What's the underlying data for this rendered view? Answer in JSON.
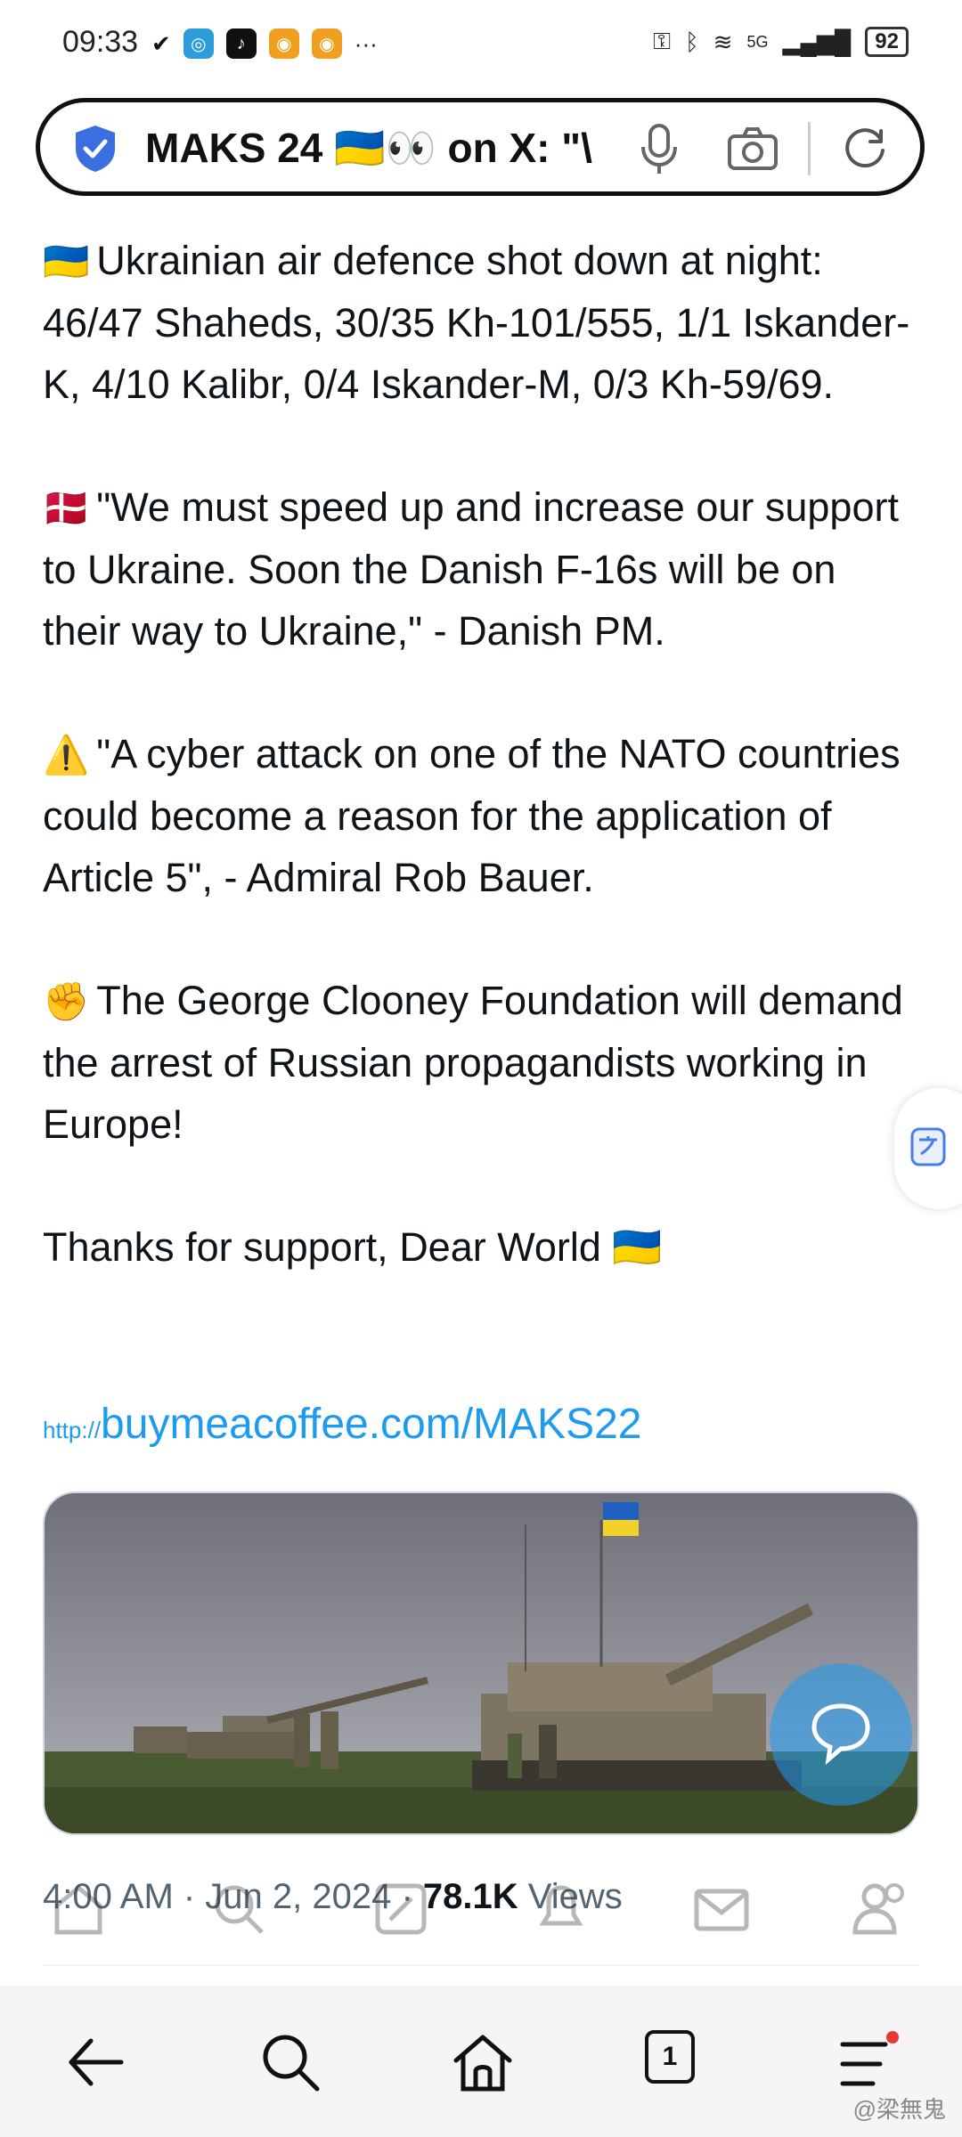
{
  "status_bar": {
    "time": "09:33",
    "more": "···",
    "network": "5G",
    "battery": "92"
  },
  "address_bar": {
    "text": "MAKS 24 🇺🇦👀 on X: \"\\"
  },
  "tweet": {
    "paragraphs": [
      {
        "emoji": "🇺🇦",
        "text": "Ukrainian air defence shot down at night: 46/47 Shaheds, 30/35 Kh-101/555, 1/1 Iskander-K, 4/10 Kalibr, 0/4 Iskander-M, 0/3 Kh-59/69."
      },
      {
        "emoji": "🇩🇰",
        "text": "\"We must speed up and increase our support to Ukraine. Soon the Danish F-16s will be on their way to Ukraine,\" - Danish PM."
      },
      {
        "emoji": "⚠️",
        "text": "\"A cyber attack on one of the NATO countries could become a reason for the application of Article 5\", - Admiral Rob Bauer."
      },
      {
        "emoji": "✊",
        "text": "The George Clooney Foundation will demand the arrest of Russian propagandists working in Europe!"
      },
      {
        "emoji": "",
        "text": "Thanks for support, Dear World 🇺🇦"
      }
    ],
    "link_prefix": "http://",
    "link_text": "buymeacoffee.com/MAKS22",
    "timestamp": "4:00 AM · Jun 2, 2024 · ",
    "views_count": "78.1K",
    "views_label": " Views"
  },
  "browser_bar": {
    "tab_count": "1"
  },
  "watermark": "@梁無鬼",
  "colors": {
    "link": "#1d9bf0",
    "accent_shield": "#3b6fe0"
  }
}
